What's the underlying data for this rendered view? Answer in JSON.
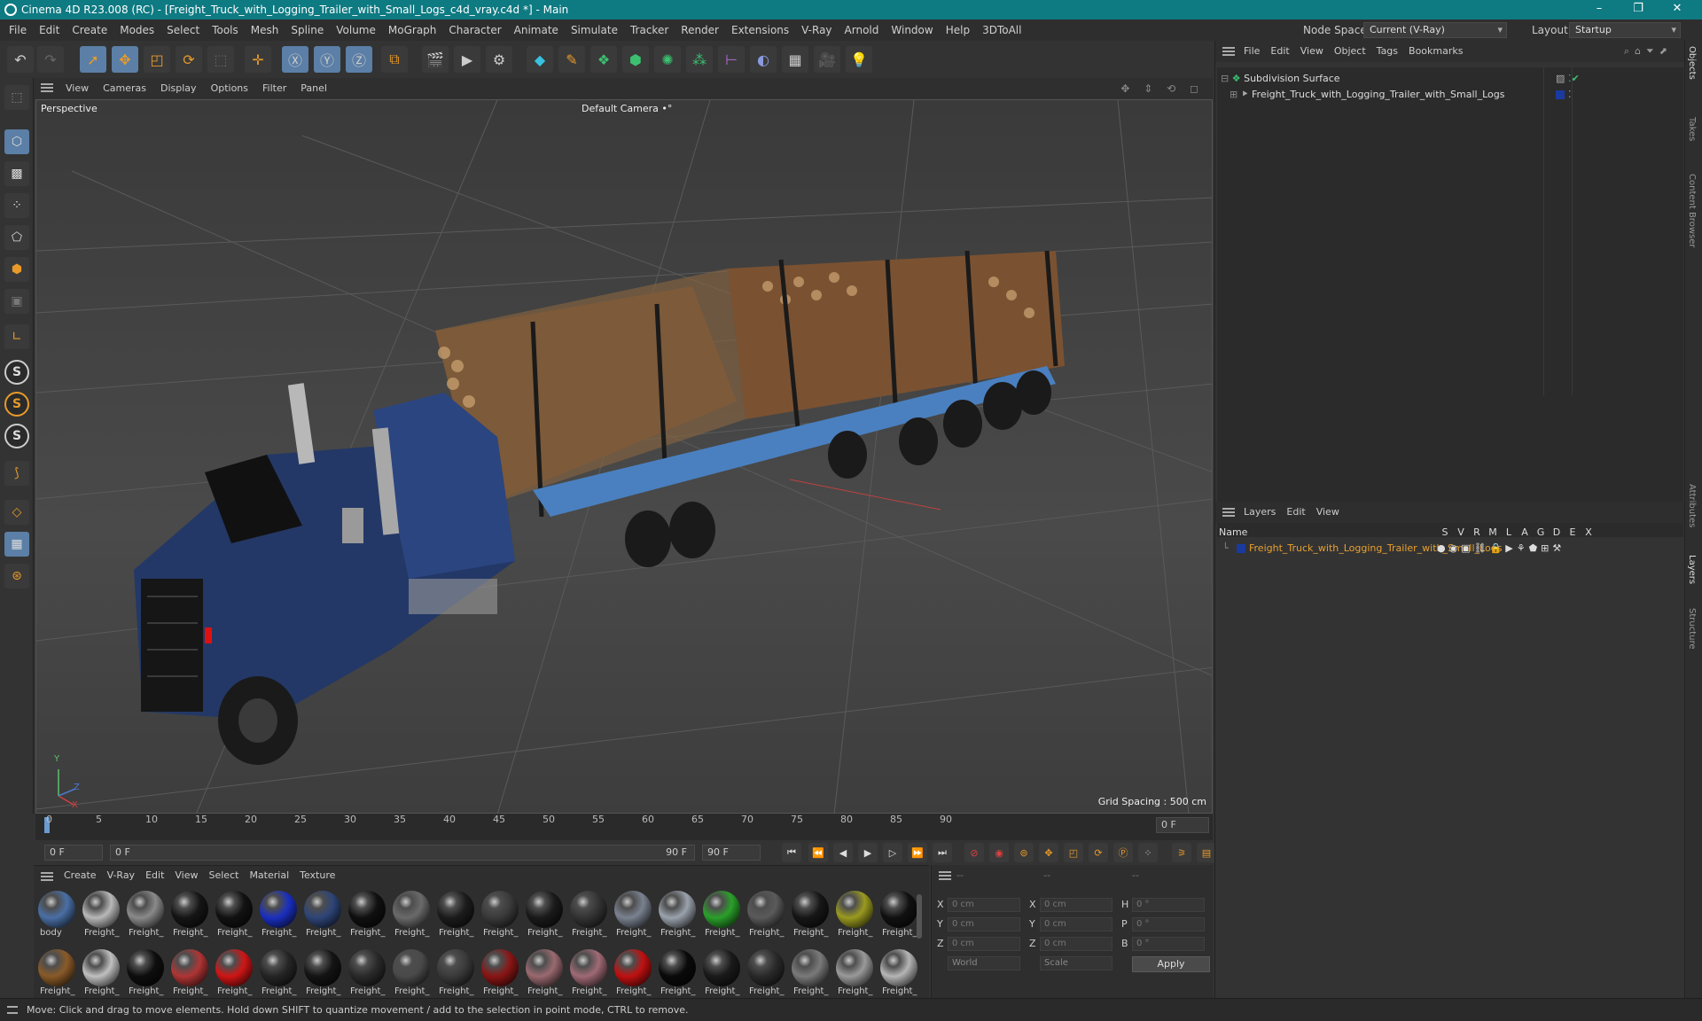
{
  "window": {
    "title": "Cinema 4D R23.008 (RC) - [Freight_Truck_with_Logging_Trailer_with_Small_Logs_c4d_vray.c4d *] - Main",
    "minimize": "–",
    "restore": "❐",
    "close": "✕"
  },
  "menubar": {
    "items": [
      "File",
      "Edit",
      "Create",
      "Modes",
      "Select",
      "Tools",
      "Mesh",
      "Spline",
      "Volume",
      "MoGraph",
      "Character",
      "Animate",
      "Simulate",
      "Tracker",
      "Render",
      "Extensions",
      "V-Ray",
      "Arnold",
      "Window",
      "Help",
      "3DToAll"
    ],
    "node_space_label": "Node Space:",
    "node_space_value": "Current (V-Ray)",
    "layout_label": "Layout:",
    "layout_value": "Startup"
  },
  "viewport_menu": {
    "items": [
      "View",
      "Cameras",
      "Display",
      "Options",
      "Filter",
      "Panel"
    ],
    "nav_icons": "✥ ⇕ ⟲ ◻"
  },
  "viewport": {
    "label": "Perspective",
    "camera": "Default Camera",
    "camera_icon": "•°",
    "grid_spacing": "Grid Spacing : 500 cm",
    "axis_x": "X",
    "axis_y": "Y",
    "axis_z": "Z"
  },
  "timeline": {
    "ticks": [
      "0",
      "5",
      "10",
      "15",
      "20",
      "25",
      "30",
      "35",
      "40",
      "45",
      "50",
      "55",
      "60",
      "65",
      "70",
      "75",
      "80",
      "85",
      "90"
    ],
    "current_frame": "0 F"
  },
  "playbar": {
    "start_frame": "0 F",
    "range_start": "0 F",
    "range_end": "90 F",
    "end_frame": "90 F"
  },
  "materials": {
    "menu": [
      "Create",
      "V-Ray",
      "Edit",
      "View",
      "Select",
      "Material",
      "Texture"
    ],
    "row1": [
      {
        "label": "body",
        "color": "#4a6fa5"
      },
      {
        "label": "Freight_",
        "color": "#b8b8b8"
      },
      {
        "label": "Freight_",
        "color": "#8a8a8a"
      },
      {
        "label": "Freight_",
        "color": "#151515"
      },
      {
        "label": "Freight_",
        "color": "#121212"
      },
      {
        "label": "Freight_",
        "color": "#1a2fc0"
      },
      {
        "label": "Freight_",
        "color": "#2e4577"
      },
      {
        "label": "Freight_",
        "color": "#101010"
      },
      {
        "label": "Freight_",
        "color": "#6a6a6a"
      },
      {
        "label": "Freight_",
        "color": "#1c1c1c"
      },
      {
        "label": "Freight_",
        "color": "#3a3a3a"
      },
      {
        "label": "Freight_",
        "color": "#1a1a1a"
      },
      {
        "label": "Freight_",
        "color": "#333333"
      },
      {
        "label": "Freight_",
        "color": "#7a8290"
      },
      {
        "label": "Freight_",
        "color": "#9aa2ac"
      },
      {
        "label": "Freight_",
        "color": "#2aa02a"
      },
      {
        "label": "Freight_",
        "color": "#5a5a5a"
      },
      {
        "label": "Freight_",
        "color": "#161616"
      },
      {
        "label": "Freight_",
        "color": "#9a9a20"
      },
      {
        "label": "Freight_",
        "color": "#111111"
      }
    ],
    "row2": [
      {
        "label": "Freight_",
        "color": "#8a5a28"
      },
      {
        "label": "Freight_",
        "color": "#c0c0c0"
      },
      {
        "label": "Freight_",
        "color": "#0e0e0e"
      },
      {
        "label": "Freight_",
        "color": "#b03535"
      },
      {
        "label": "Freight_",
        "color": "#d01515"
      },
      {
        "label": "Freight_",
        "color": "#252525"
      },
      {
        "label": "Freight_",
        "color": "#141414"
      },
      {
        "label": "Freight_",
        "color": "#2a2a2a"
      },
      {
        "label": "Freight_",
        "color": "#4a4a4a"
      },
      {
        "label": "Freight_",
        "color": "#3a3a3a"
      },
      {
        "label": "Freight_",
        "color": "#8a1515"
      },
      {
        "label": "Freight_",
        "color": "#9a6a70"
      },
      {
        "label": "Freight_",
        "color": "#a06a75"
      },
      {
        "label": "Freight_",
        "color": "#c01010"
      },
      {
        "label": "Freight_",
        "color": "#0a0a0a"
      },
      {
        "label": "Freight_",
        "color": "#1a1a1a"
      },
      {
        "label": "Freight_",
        "color": "#2a2a2a"
      },
      {
        "label": "Freight_",
        "color": "#7a7a7a"
      },
      {
        "label": "Freight_",
        "color": "#9a9a9a"
      },
      {
        "label": "Freight_",
        "color": "#b5b5b5"
      }
    ]
  },
  "coords": {
    "col_heads": [
      "--",
      "--",
      "--"
    ],
    "x_label": "X",
    "y_label": "Y",
    "z_label": "Z",
    "x2_label": "X",
    "y2_label": "Y",
    "z2_label": "Z",
    "h_label": "H",
    "p_label": "P",
    "b_label": "B",
    "pos_x": "0 cm",
    "pos_y": "0 cm",
    "pos_z": "0 cm",
    "size_x": "0 cm",
    "size_y": "0 cm",
    "size_z": "0 cm",
    "rot_h": "0 °",
    "rot_p": "0 °",
    "rot_b": "0 °",
    "space": "World",
    "mode": "Scale",
    "apply": "Apply"
  },
  "objects_panel": {
    "menu": [
      "File",
      "Edit",
      "View",
      "Object",
      "Tags",
      "Bookmarks"
    ],
    "rows": [
      {
        "name": "Subdivision Surface"
      },
      {
        "name": "Freight_Truck_with_Logging_Trailer_with_Small_Logs"
      }
    ]
  },
  "layers_panel": {
    "menu": [
      "Layers",
      "Edit",
      "View"
    ],
    "name_header": "Name",
    "flag_headers": [
      "S",
      "V",
      "R",
      "M",
      "L",
      "A",
      "G",
      "D",
      "E",
      "X"
    ],
    "row_name": "Freight_Truck_with_Logging_Trailer_with_Small_Logs",
    "row_color": "#1a3aa0"
  },
  "side_tabs": [
    "Objects",
    "Takes",
    "Content Browser",
    "Attributes",
    "Layers",
    "Structure"
  ],
  "status": "Move: Click and drag to move elements. Hold down SHIFT to quantize movement / add to the selection in point mode, CTRL to remove."
}
